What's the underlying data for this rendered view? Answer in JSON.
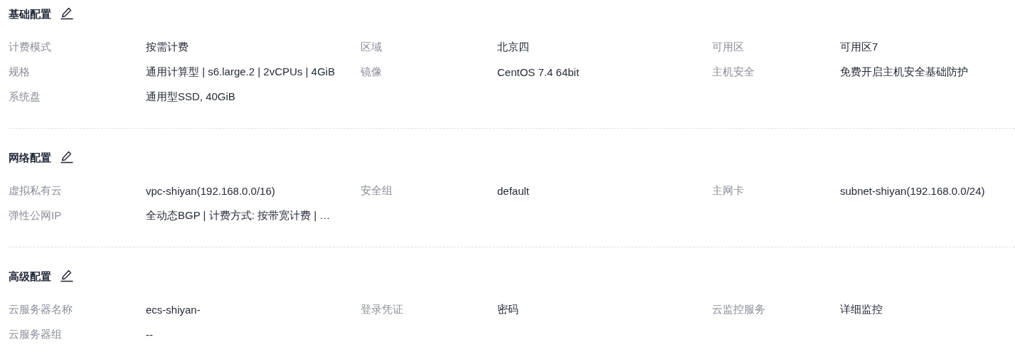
{
  "sections": [
    {
      "title": "基础配置",
      "items": [
        {
          "label": "计费模式",
          "value": "按需计费"
        },
        {
          "label": "区域",
          "value": "北京四"
        },
        {
          "label": "可用区",
          "value": "可用区7"
        },
        {
          "label": "规格",
          "value": "通用计算型 | s6.large.2 | 2vCPUs | 4GiB"
        },
        {
          "label": "镜像",
          "value": "CentOS 7.4 64bit"
        },
        {
          "label": "主机安全",
          "value": "免费开启主机安全基础防护"
        },
        {
          "label": "系统盘",
          "value": "通用型SSD, 40GiB"
        }
      ]
    },
    {
      "title": "网络配置",
      "items": [
        {
          "label": "虚拟私有云",
          "value": "vpc-shiyan(192.168.0.0/16)"
        },
        {
          "label": "安全组",
          "value": "default"
        },
        {
          "label": "主网卡",
          "value": "subnet-shiyan(192.168.0.0/24)"
        },
        {
          "label": "弹性公网IP",
          "value": "全动态BGP | 计费方式: 按带宽计费 | …"
        }
      ]
    },
    {
      "title": "高级配置",
      "items": [
        {
          "label": "云服务器名称",
          "value": "ecs-shiyan-"
        },
        {
          "label": "登录凭证",
          "value": "密码"
        },
        {
          "label": "云监控服务",
          "value": "详细监控"
        },
        {
          "label": "云服务器组",
          "value": "--"
        }
      ]
    }
  ]
}
